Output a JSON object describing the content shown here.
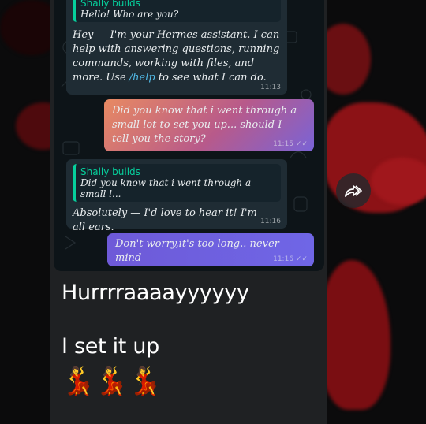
{
  "chat": {
    "bubble1": {
      "quoted_name": "Shally builds",
      "quoted_text": "Hello! Who are you?",
      "text_before_link": "Hey — I'm your Hermes assistant. I can help with answering questions, running commands, working with files, and more. Use ",
      "link": "/help",
      "text_after_link": " to see what I can do.",
      "time": "11:13"
    },
    "bubble2": {
      "text": "Did you know that i went through a small lot to set you up... should I tell you the story?",
      "time": "11:15"
    },
    "bubble3": {
      "quoted_name": "Shally builds",
      "quoted_text": "Did you know that i went through a small l...",
      "text": "Absolutely — I'd love to hear it! I'm all ears.",
      "time": "11:16"
    },
    "bubble4": {
      "text": "Don't worry,it's too long.. never mind",
      "time": "11:16"
    }
  },
  "caption": {
    "line1": "Hurrrraaaayyyyyy",
    "line2": "I set it up",
    "emoji": "💃💃💃"
  },
  "colors": {
    "accent": "#06cf9c",
    "link": "#53bdeb",
    "incoming": "#1f2c34"
  },
  "icons": [
    "forward-icon",
    "double-check-icon",
    "dancer-emoji"
  ]
}
